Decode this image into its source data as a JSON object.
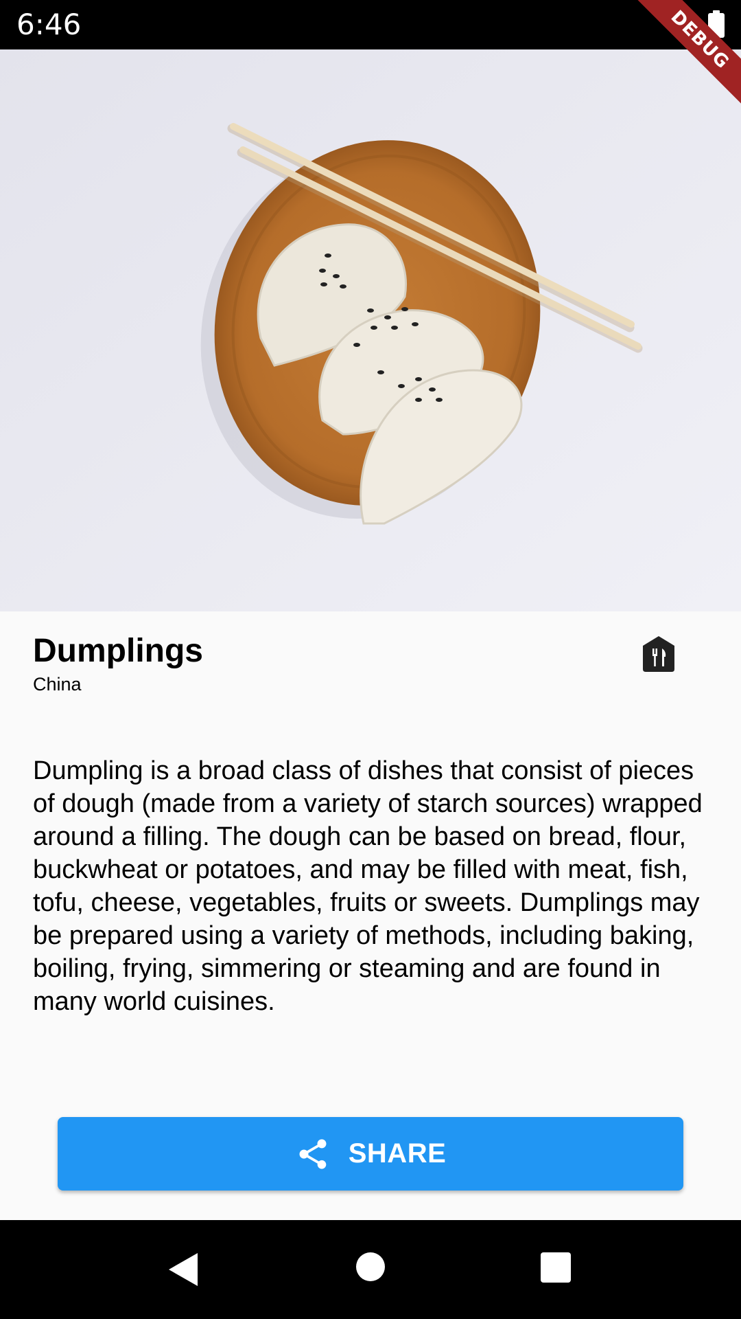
{
  "status_bar": {
    "time": "6:46",
    "icons": [
      "battery-icon"
    ]
  },
  "debug_banner": {
    "label": "DEBUG",
    "color": "#a02323"
  },
  "hero_image": {
    "subject": "dumplings on a wooden plate with chopsticks",
    "icon": "food-photo"
  },
  "dish": {
    "name": "Dumplings",
    "country": "China",
    "icon": "restaurant-icon",
    "description": "Dumpling is a broad class of dishes that consist of pieces of dough (made from a variety of starch sources) wrapped around a filling. The dough can be based on bread, flour, buckwheat or potatoes, and may be filled with meat, fish, tofu, cheese, vegetables, fruits or sweets. Dumplings may be prepared using a variety of methods, including baking, boiling, frying, simmering or steaming and are found in many world cuisines."
  },
  "share_button": {
    "label": "SHARE",
    "icon": "share-icon",
    "color": "#2196f3"
  },
  "nav_bar": {
    "icons": [
      "back-icon",
      "home-icon",
      "recents-icon"
    ]
  }
}
